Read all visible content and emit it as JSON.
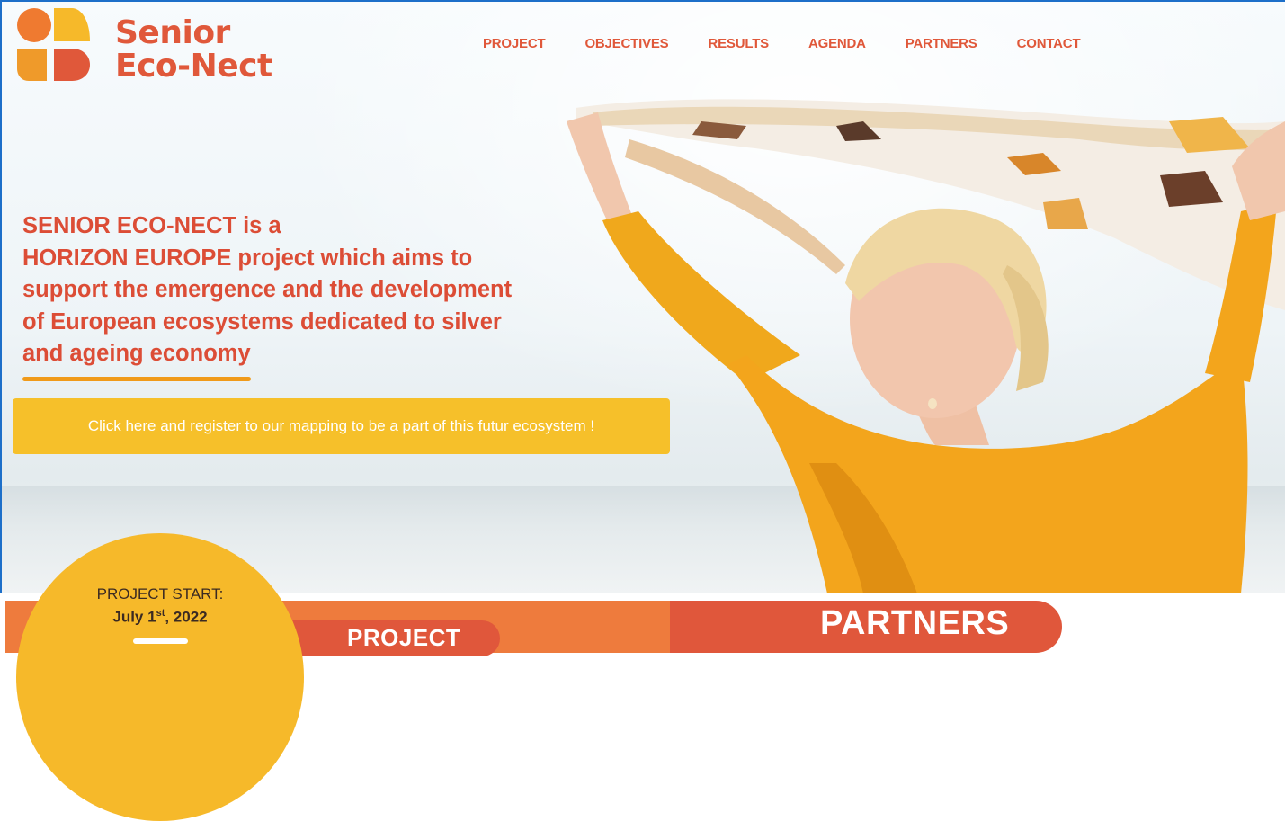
{
  "brand": {
    "name_line1": "Senior",
    "name_line2": "Eco-Nect",
    "primary_color": "#e0583a",
    "accent_orange": "#f09a1a",
    "accent_yellow": "#f6c02a"
  },
  "nav": {
    "items": [
      {
        "label": "PROJECT"
      },
      {
        "label": "OBJECTIVES"
      },
      {
        "label": "RESULTS"
      },
      {
        "label": "AGENDA"
      },
      {
        "label": "PARTNERS"
      },
      {
        "label": "CONTACT"
      }
    ]
  },
  "hero": {
    "headline_lines": [
      "SENIOR ECO-NECT is a",
      "HORIZON EUROPE project which aims to",
      "support the emergence and the development",
      "of European ecosystems dedicated to silver",
      "and ageing economy"
    ],
    "cta_label": "Click here and register to our mapping to be a part of this futur ecosystem !"
  },
  "project_start": {
    "label": "PROJECT START:",
    "date_month_day": "July 1",
    "date_suffix": "st",
    "date_year": ", 2022"
  },
  "sections": {
    "project_label": "PROJECT",
    "partners_label": "PARTNERS"
  },
  "photo": {
    "icon": "woman-with-scarf-photo"
  }
}
